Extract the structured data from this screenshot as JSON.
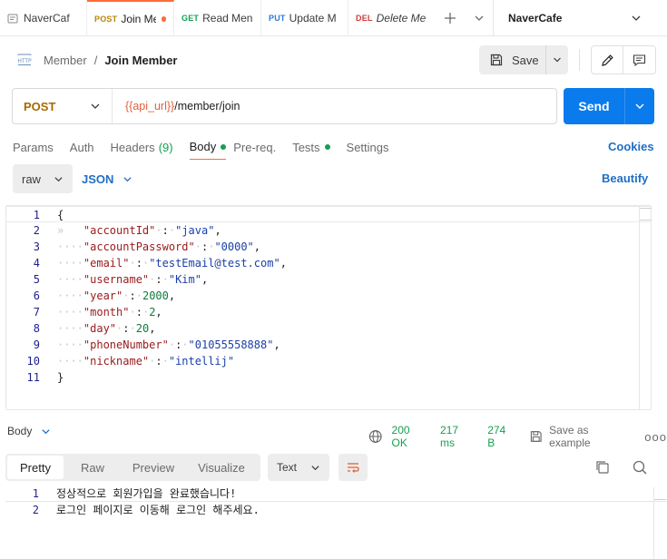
{
  "tabs": [
    {
      "method": "",
      "name": "NaverCaf",
      "active": false
    },
    {
      "method": "POST",
      "name": "Join Me",
      "active": true,
      "unsaved": true
    },
    {
      "method": "GET",
      "name": "Read Men",
      "active": false
    },
    {
      "method": "PUT",
      "name": "Update M",
      "active": false
    },
    {
      "method": "DEL",
      "name": "Delete Me",
      "active": false
    }
  ],
  "environment": "NaverCafe",
  "breadcrumb": {
    "parent": "Member",
    "separator": "/",
    "current": "Join Member"
  },
  "toolbar": {
    "save_label": "Save"
  },
  "request": {
    "method": "POST",
    "url_variable": "{{api_url}}",
    "url_path": "/member/join",
    "send_label": "Send"
  },
  "request_tabs": {
    "params": "Params",
    "auth": "Auth",
    "headers": "Headers",
    "headers_count": "(9)",
    "body": "Body",
    "prereq": "Pre-req.",
    "tests": "Tests",
    "settings": "Settings",
    "cookies": "Cookies"
  },
  "body_mode": {
    "mode": "raw",
    "language": "JSON",
    "beautify": "Beautify"
  },
  "editor": {
    "line_numbers": [
      "1",
      "2",
      "3",
      "4",
      "5",
      "6",
      "7",
      "8",
      "9",
      "10",
      "11"
    ],
    "lines": [
      {
        "open": "{"
      },
      {
        "key": "\"accountId\"",
        "value": "\"java\"",
        "type": "string",
        "comma": ","
      },
      {
        "key": "\"accountPassword\"",
        "value": "\"0000\"",
        "type": "string",
        "comma": ","
      },
      {
        "key": "\"email\"",
        "value": "\"testEmail@test.com\"",
        "type": "string",
        "comma": ","
      },
      {
        "key": "\"username\"",
        "value": "\"Kim\"",
        "type": "string",
        "comma": ","
      },
      {
        "key": "\"year\"",
        "value": "2000",
        "type": "number",
        "comma": ","
      },
      {
        "key": "\"month\"",
        "value": "2",
        "type": "number",
        "comma": ","
      },
      {
        "key": "\"day\"",
        "value": "20",
        "type": "number",
        "comma": ","
      },
      {
        "key": "\"phoneNumber\"",
        "value": "\"01055558888\"",
        "type": "string",
        "comma": ","
      },
      {
        "key": "\"nickname\"",
        "value": "\"intellij\"",
        "type": "string",
        "comma": ""
      },
      {
        "close": "}"
      }
    ]
  },
  "response": {
    "label": "Body",
    "status": "200 OK",
    "time": "217 ms",
    "size": "274 B",
    "save_example": "Save as example",
    "more": "ooo",
    "views": [
      "Pretty",
      "Raw",
      "Preview",
      "Visualize"
    ],
    "active_view": "Pretty",
    "format": "Text",
    "line_numbers": [
      "1",
      "2"
    ],
    "lines": [
      "정상적으로 회원가입을 완료했습니다!",
      "로그인 페이지로 이동해 로그인 해주세요."
    ]
  },
  "colors": {
    "accent": "#ff6c37",
    "send": "#097bed",
    "link": "#1f6fc5",
    "success": "#14a051"
  }
}
